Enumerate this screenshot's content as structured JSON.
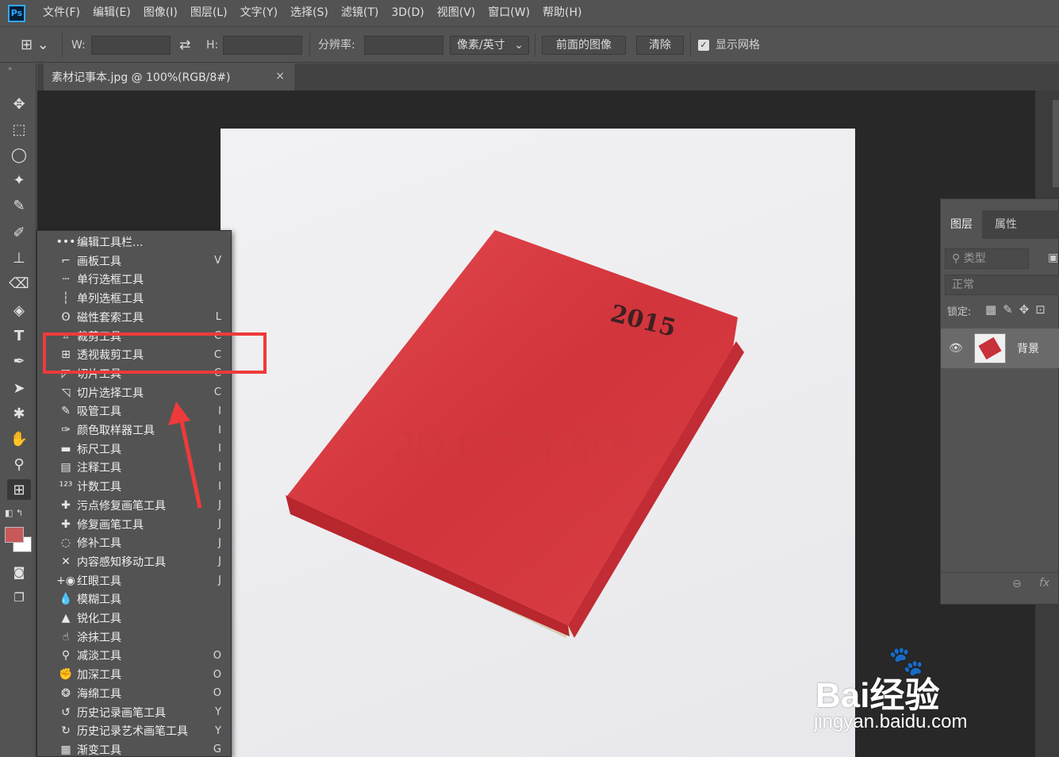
{
  "app": {
    "logo": "Ps"
  },
  "menu": [
    "文件(F)",
    "编辑(E)",
    "图像(I)",
    "图层(L)",
    "文字(Y)",
    "选择(S)",
    "滤镜(T)",
    "3D(D)",
    "视图(V)",
    "窗口(W)",
    "帮助(H)"
  ],
  "options": {
    "w_label": "W:",
    "h_label": "H:",
    "resolution_label": "分辨率:",
    "unit": "像素/英寸",
    "front_image": "前面的图像",
    "clear": "清除",
    "show_grid": "显示网格"
  },
  "document": {
    "tab_title": "素材记事本.jpg @ 100%(RGB/8#)",
    "close": "×"
  },
  "photo": {
    "year": "2015",
    "jd_watermark": "JD.COM 京东"
  },
  "layers": {
    "tab_layers": "图层",
    "tab_properties": "属性",
    "kind_placeholder": "类型",
    "blend_mode": "正常",
    "lock_label": "锁定:",
    "layer_name": "背景"
  },
  "flyout": [
    {
      "icon": "dots-icon",
      "glyph": "•••",
      "label": "编辑工具栏...",
      "key": ""
    },
    {
      "icon": "artboard-icon",
      "glyph": "⌐",
      "label": "画板工具",
      "key": "V"
    },
    {
      "icon": "single-row-marquee-icon",
      "glyph": "┄",
      "label": "单行选框工具",
      "key": ""
    },
    {
      "icon": "single-column-marquee-icon",
      "glyph": "┆",
      "label": "单列选框工具",
      "key": ""
    },
    {
      "icon": "magnetic-lasso-icon",
      "glyph": "ʘ",
      "label": "磁性套索工具",
      "key": "L"
    },
    {
      "icon": "crop-icon",
      "glyph": "⌗",
      "label": "裁剪工具",
      "key": "C"
    },
    {
      "icon": "perspective-crop-icon",
      "glyph": "⊞",
      "label": "透视裁剪工具",
      "key": "C"
    },
    {
      "icon": "slice-icon",
      "glyph": "◸",
      "label": "切片工具",
      "key": "C"
    },
    {
      "icon": "slice-select-icon",
      "glyph": "◹",
      "label": "切片选择工具",
      "key": "C"
    },
    {
      "icon": "eyedropper-icon",
      "glyph": "✎",
      "label": "吸管工具",
      "key": "I"
    },
    {
      "icon": "color-sampler-icon",
      "glyph": "✑",
      "label": "颜色取样器工具",
      "key": "I"
    },
    {
      "icon": "ruler-icon",
      "glyph": "▬",
      "label": "标尺工具",
      "key": "I"
    },
    {
      "icon": "note-icon",
      "glyph": "▤",
      "label": "注释工具",
      "key": "I"
    },
    {
      "icon": "count-icon",
      "glyph": "¹²³",
      "label": "计数工具",
      "key": "I"
    },
    {
      "icon": "spot-healing-icon",
      "glyph": "✚",
      "label": "污点修复画笔工具",
      "key": "J"
    },
    {
      "icon": "healing-brush-icon",
      "glyph": "✚",
      "label": "修复画笔工具",
      "key": "J"
    },
    {
      "icon": "patch-icon",
      "glyph": "◌",
      "label": "修补工具",
      "key": "J"
    },
    {
      "icon": "content-aware-move-icon",
      "glyph": "✕",
      "label": "内容感知移动工具",
      "key": "J"
    },
    {
      "icon": "red-eye-icon",
      "glyph": "+◉",
      "label": "红眼工具",
      "key": "J"
    },
    {
      "icon": "blur-icon",
      "glyph": "💧",
      "label": "模糊工具",
      "key": ""
    },
    {
      "icon": "sharpen-icon",
      "glyph": "▲",
      "label": "锐化工具",
      "key": ""
    },
    {
      "icon": "smudge-icon",
      "glyph": "☝",
      "label": "涂抹工具",
      "key": ""
    },
    {
      "icon": "dodge-icon",
      "glyph": "⚲",
      "label": "减淡工具",
      "key": "O"
    },
    {
      "icon": "burn-icon",
      "glyph": "✊",
      "label": "加深工具",
      "key": "O"
    },
    {
      "icon": "sponge-icon",
      "glyph": "❂",
      "label": "海绵工具",
      "key": "O"
    },
    {
      "icon": "history-brush-icon",
      "glyph": "↺",
      "label": "历史记录画笔工具",
      "key": "Y"
    },
    {
      "icon": "art-history-brush-icon",
      "glyph": "↻",
      "label": "历史记录艺术画笔工具",
      "key": "Y"
    },
    {
      "icon": "gradient-icon",
      "glyph": "▦",
      "label": "渐变工具",
      "key": "G"
    }
  ],
  "watermark": {
    "brand": "Bai经验",
    "url": "jingyan.baidu.com"
  },
  "colors": {
    "foreground": "#c8595a",
    "background": "#ffffff",
    "highlight": "#ee3a3a",
    "book": "#d63a40"
  }
}
